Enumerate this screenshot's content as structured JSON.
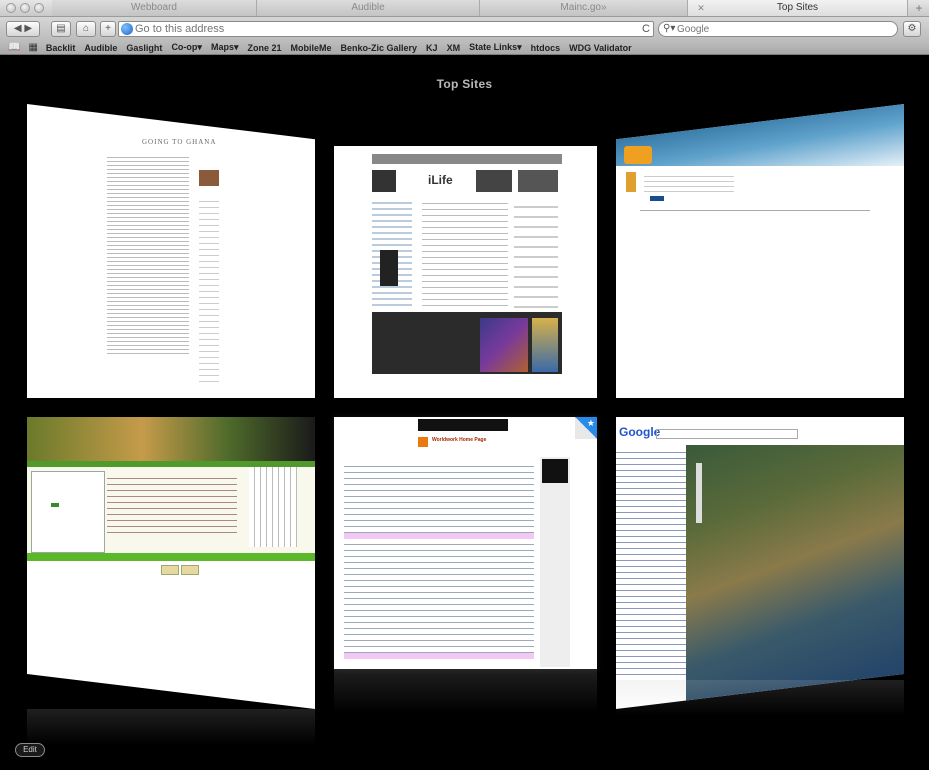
{
  "window": {
    "tabs": [
      {
        "label": "Webboard"
      },
      {
        "label": "Audible"
      },
      {
        "label": "Mainc.go»"
      },
      {
        "label": "Top Sites"
      }
    ]
  },
  "toolbar": {
    "address_placeholder": "Go to this address",
    "search_placeholder": "Google",
    "reload_glyph": "C"
  },
  "bookmarks": [
    {
      "label": "Backlit"
    },
    {
      "label": "Audible"
    },
    {
      "label": "Gaslight"
    },
    {
      "label": "Co-op▾"
    },
    {
      "label": "Maps▾"
    },
    {
      "label": "Zone 21"
    },
    {
      "label": "MobileMe"
    },
    {
      "label": "Benko-Zic Gallery"
    },
    {
      "label": "KJ"
    },
    {
      "label": "XM"
    },
    {
      "label": "State Links▾"
    },
    {
      "label": "htdocs"
    },
    {
      "label": "WDG Validator"
    }
  ],
  "top_sites": {
    "title": "Top Sites",
    "edit_label": "Edit",
    "thumbnails": [
      {
        "title": "GOING TO GHANA"
      },
      {
        "title": "iLife"
      },
      {
        "title": ""
      },
      {
        "title": ""
      },
      {
        "title": "Worldwork Home Page"
      },
      {
        "title": "Google"
      }
    ]
  },
  "colors": {
    "background": "#000000",
    "title_gray": "#b9b9b9",
    "toolbar": "#c8c8c8"
  }
}
